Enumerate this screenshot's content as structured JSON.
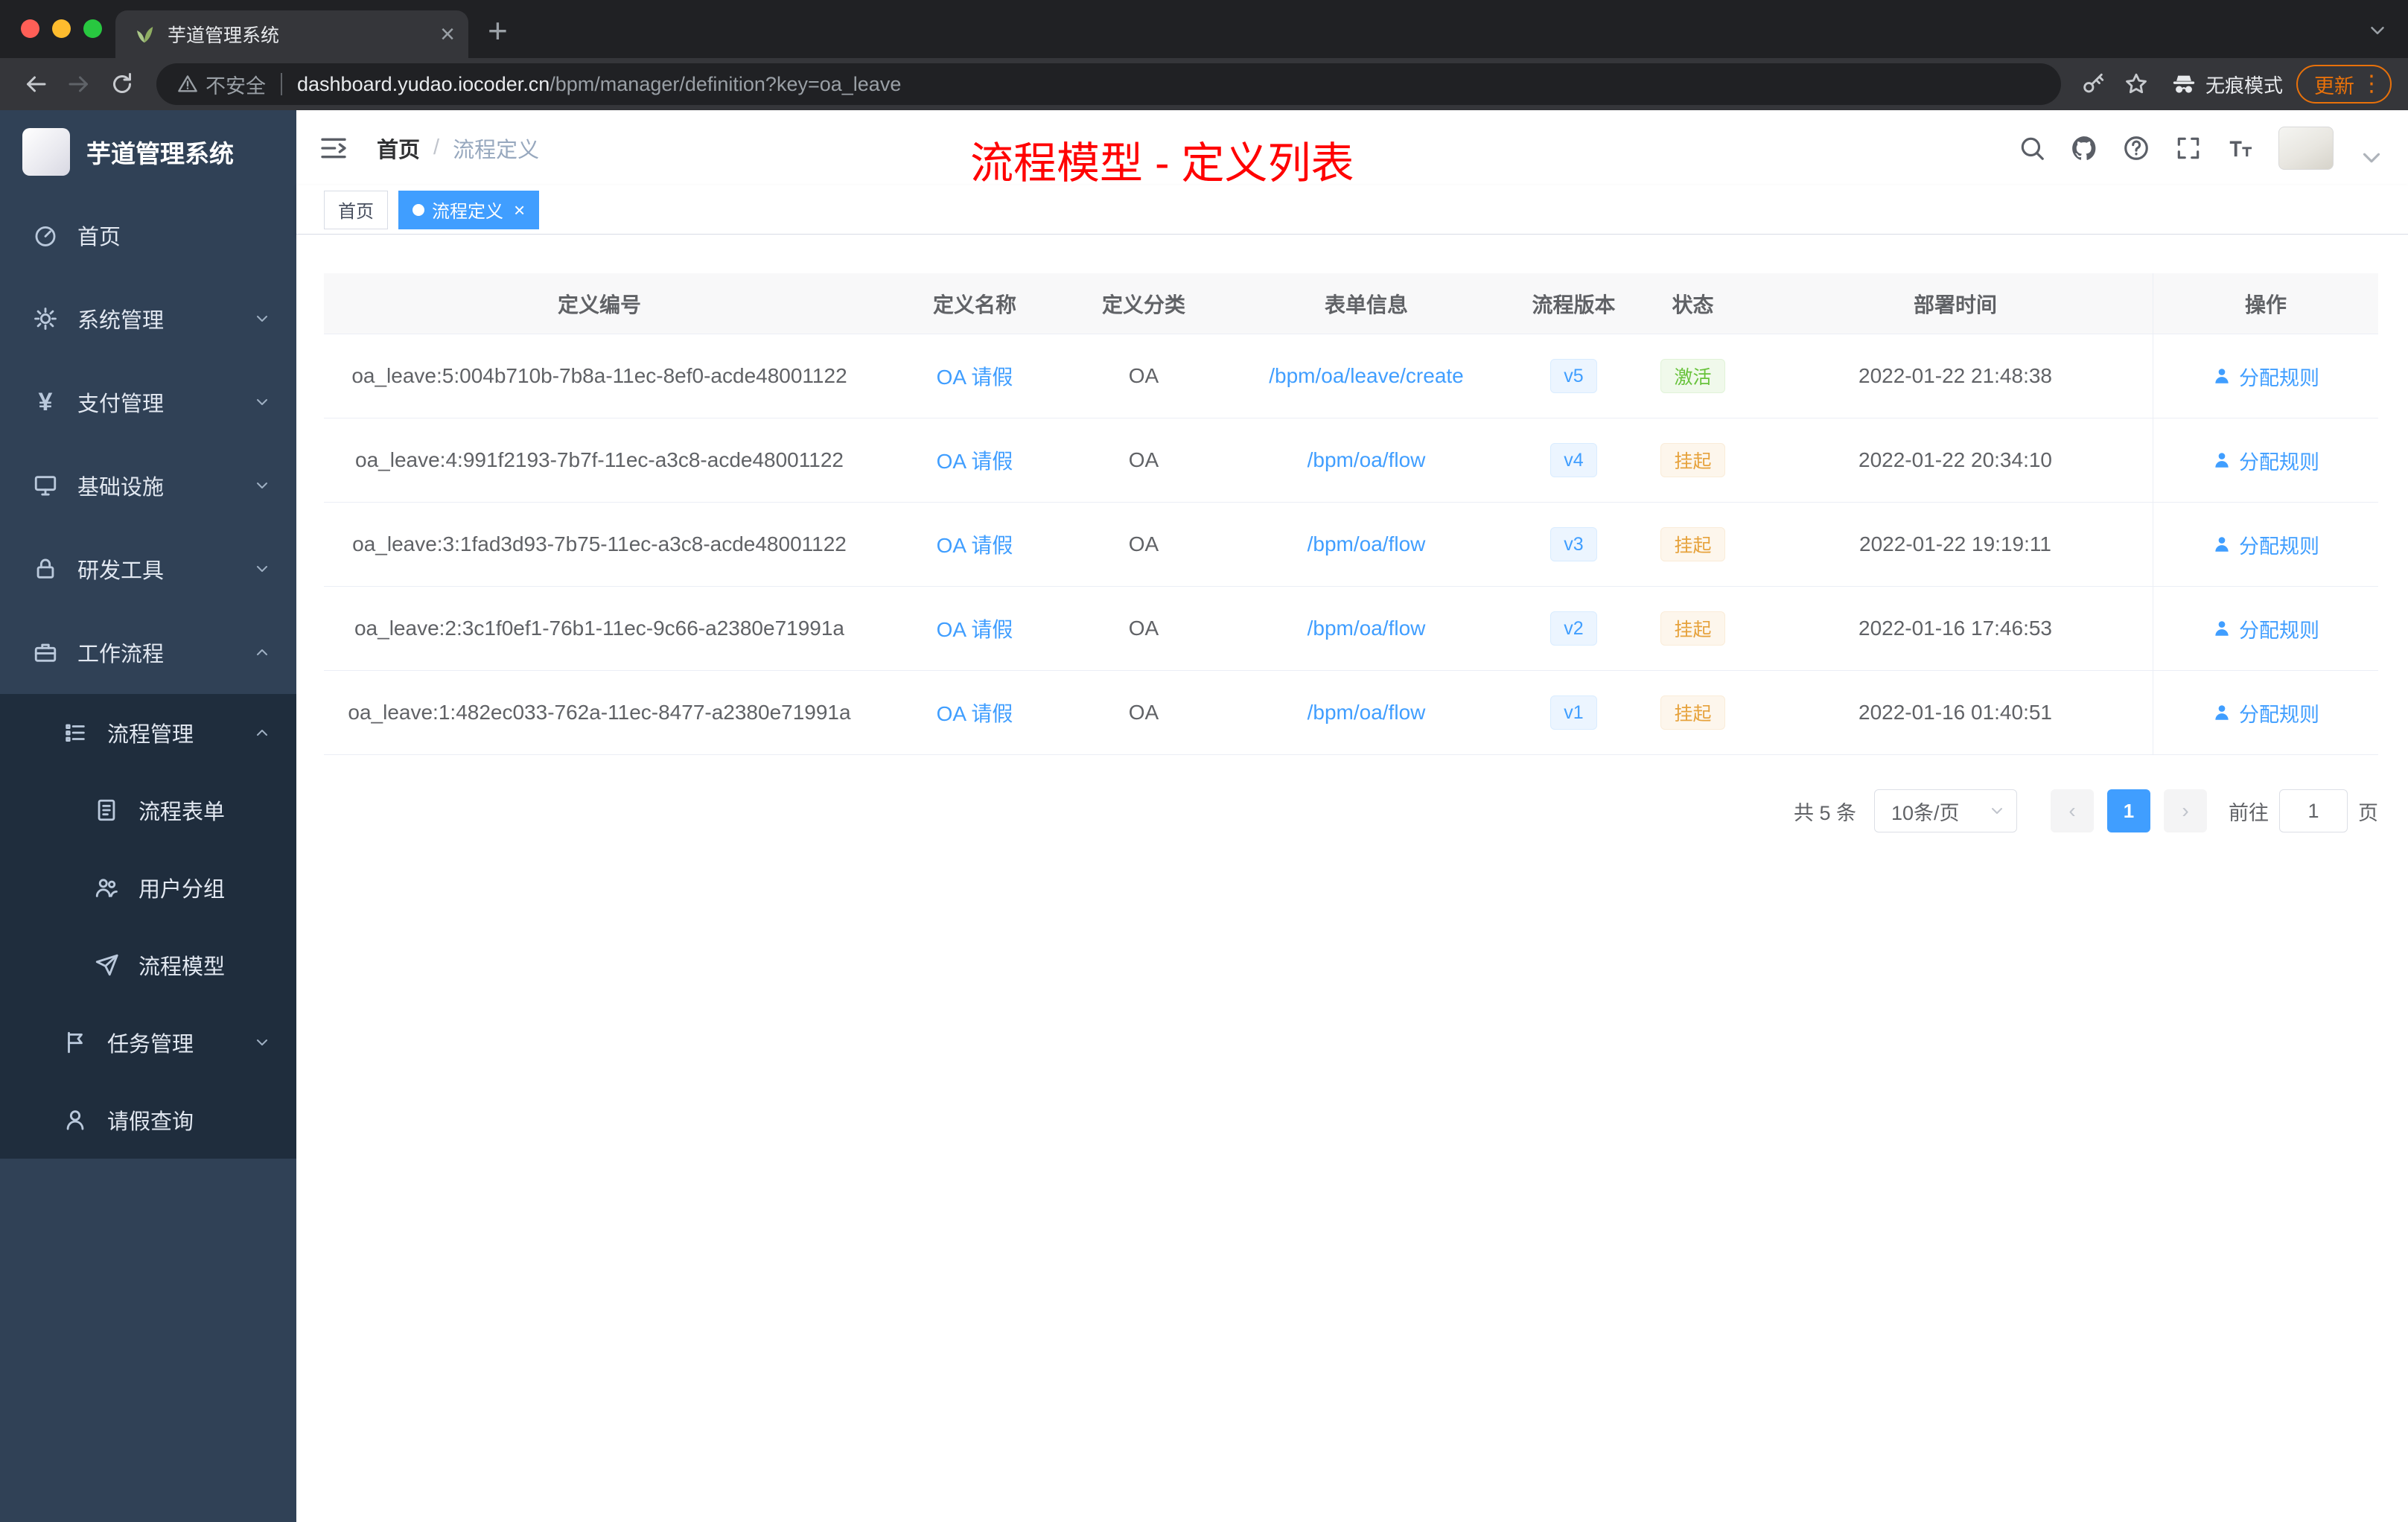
{
  "browser": {
    "tab": {
      "title": "芋道管理系统"
    },
    "address": {
      "security_label": "不安全",
      "host": "dashboard.yudao.iocoder.cn",
      "path": "/bpm/manager/definition?key=oa_leave"
    },
    "incognito_label": "无痕模式",
    "update_label": "更新"
  },
  "sidebar": {
    "logo_title": "芋道管理系统",
    "items": [
      {
        "label": "首页",
        "icon": "dashboard-icon",
        "level": 1
      },
      {
        "label": "系统管理",
        "icon": "gear-icon",
        "level": 1,
        "arrow": "down"
      },
      {
        "label": "支付管理",
        "icon": "yen-icon",
        "level": 1,
        "arrow": "down"
      },
      {
        "label": "基础设施",
        "icon": "monitor-icon",
        "level": 1,
        "arrow": "down"
      },
      {
        "label": "研发工具",
        "icon": "lock-icon",
        "level": 1,
        "arrow": "down"
      },
      {
        "label": "工作流程",
        "icon": "briefcase-icon",
        "level": 1,
        "arrow": "up"
      },
      {
        "label": "流程管理",
        "icon": "tree-icon",
        "level": 2,
        "arrow": "up",
        "sub": true
      },
      {
        "label": "流程表单",
        "icon": "form-icon",
        "level": 3,
        "sub": true
      },
      {
        "label": "用户分组",
        "icon": "users-icon",
        "level": 3,
        "sub": true
      },
      {
        "label": "流程模型",
        "icon": "send-icon",
        "level": 3,
        "sub": true
      },
      {
        "label": "任务管理",
        "icon": "task-icon",
        "level": 2,
        "arrow": "down",
        "sub": true
      },
      {
        "label": "请假查询",
        "icon": "user-icon",
        "level": 2,
        "sub": true
      }
    ]
  },
  "header": {
    "breadcrumb": {
      "home": "首页",
      "separator": "/",
      "current": "流程定义"
    },
    "overlay_title": "流程模型 - 定义列表"
  },
  "tags": [
    {
      "label": "首页"
    },
    {
      "label": "流程定义"
    }
  ],
  "table": {
    "columns": [
      "定义编号",
      "定义名称",
      "定义分类",
      "表单信息",
      "流程版本",
      "状态",
      "部署时间",
      "操作"
    ],
    "rows": [
      {
        "id": "oa_leave:5:004b710b-7b8a-11ec-8ef0-acde48001122",
        "name": "OA 请假",
        "category": "OA",
        "form": "/bpm/oa/leave/create",
        "version": "v5",
        "status": "激活",
        "status_type": "success",
        "deploy_time": "2022-01-22 21:48:38",
        "action": "分配规则"
      },
      {
        "id": "oa_leave:4:991f2193-7b7f-11ec-a3c8-acde48001122",
        "name": "OA 请假",
        "category": "OA",
        "form": "/bpm/oa/flow",
        "version": "v4",
        "status": "挂起",
        "status_type": "warning",
        "deploy_time": "2022-01-22 20:34:10",
        "action": "分配规则"
      },
      {
        "id": "oa_leave:3:1fad3d93-7b75-11ec-a3c8-acde48001122",
        "name": "OA 请假",
        "category": "OA",
        "form": "/bpm/oa/flow",
        "version": "v3",
        "status": "挂起",
        "status_type": "warning",
        "deploy_time": "2022-01-22 19:19:11",
        "action": "分配规则"
      },
      {
        "id": "oa_leave:2:3c1f0ef1-76b1-11ec-9c66-a2380e71991a",
        "name": "OA 请假",
        "category": "OA",
        "form": "/bpm/oa/flow",
        "version": "v2",
        "status": "挂起",
        "status_type": "warning",
        "deploy_time": "2022-01-16 17:46:53",
        "action": "分配规则"
      },
      {
        "id": "oa_leave:1:482ec033-762a-11ec-8477-a2380e71991a",
        "name": "OA 请假",
        "category": "OA",
        "form": "/bpm/oa/flow",
        "version": "v1",
        "status": "挂起",
        "status_type": "warning",
        "deploy_time": "2022-01-16 01:40:51",
        "action": "分配规则"
      }
    ]
  },
  "pagination": {
    "total": "共 5 条",
    "page_size": "10条/页",
    "prev": "‹",
    "next": "›",
    "current_page": "1",
    "goto_label": "前往",
    "goto_value": "1",
    "unit_label": "页"
  },
  "colors": {
    "accent": "#409eff",
    "success": "#67c23a",
    "warning": "#e6a23c",
    "title_red": "#ff0000"
  }
}
